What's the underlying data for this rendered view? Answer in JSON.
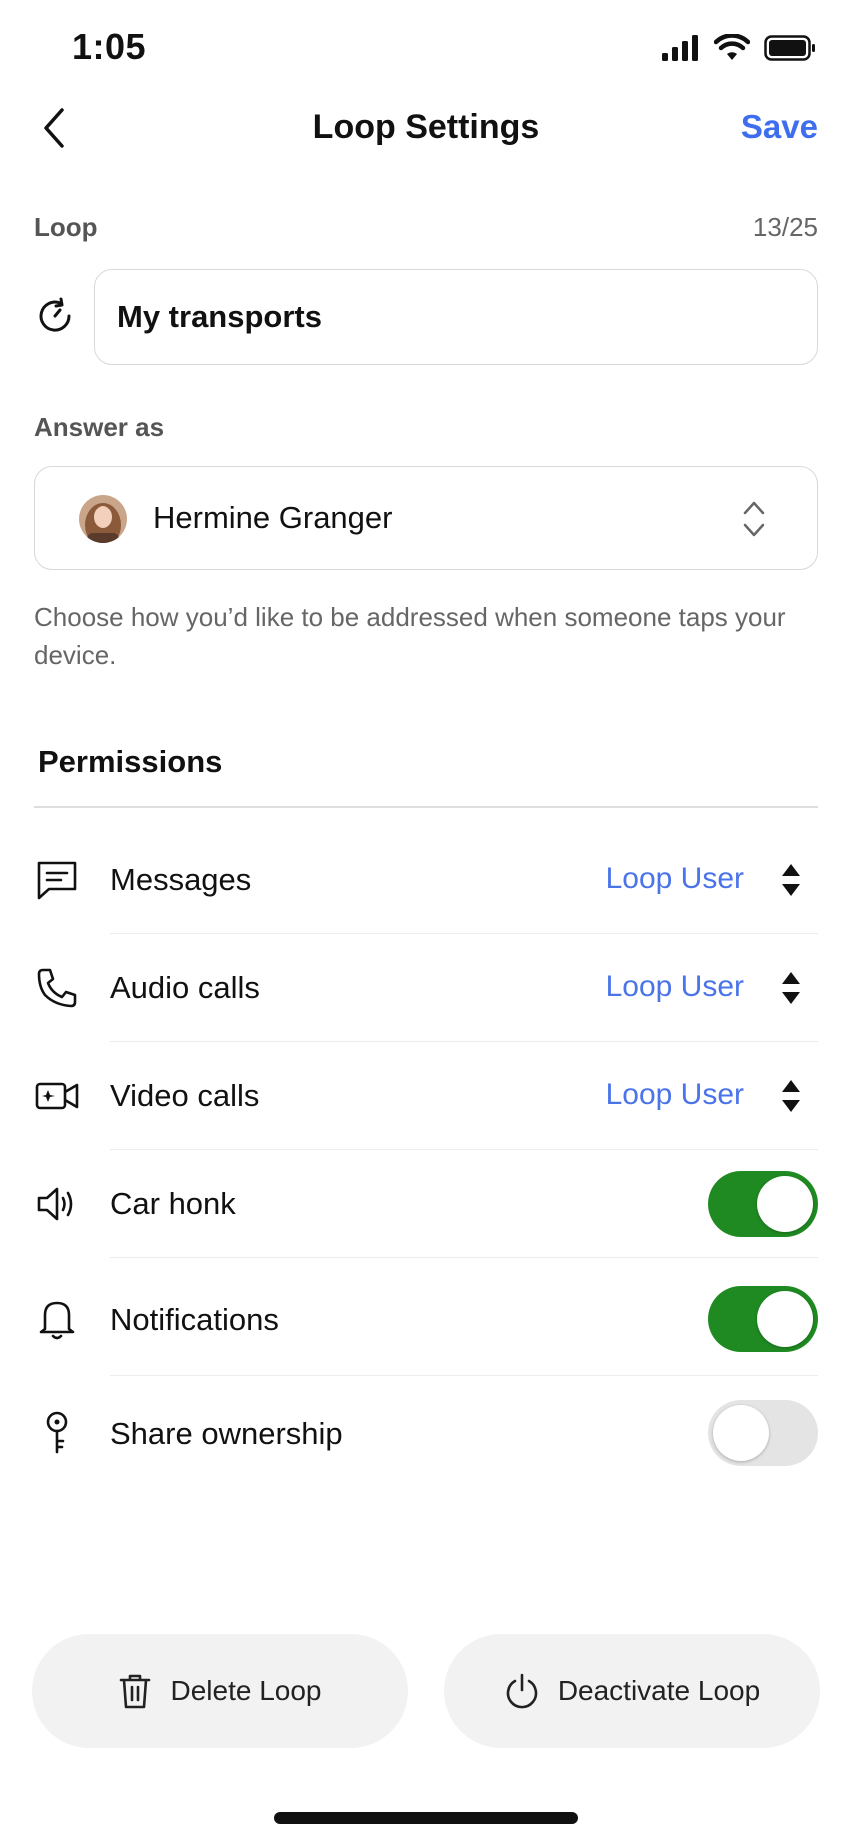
{
  "status_bar": {
    "time": "1:05"
  },
  "nav": {
    "title": "Loop Settings",
    "save_label": "Save"
  },
  "loop": {
    "label": "Loop",
    "counter": "13/25",
    "value": "My transports"
  },
  "answer_as": {
    "label": "Answer as",
    "selected": "Hermine Granger",
    "helper": "Choose how you’d like to be addressed when someone taps your device."
  },
  "permissions": {
    "title": "Permissions",
    "rows": [
      {
        "label": "Messages",
        "value": "Loop User",
        "icon": "message-icon"
      },
      {
        "label": "Audio calls",
        "value": "Loop User",
        "icon": "phone-icon"
      },
      {
        "label": "Video calls",
        "value": "Loop User",
        "icon": "video-icon"
      },
      {
        "label": "Car honk",
        "toggle": true,
        "icon": "speaker-icon"
      },
      {
        "label": "Notifications",
        "toggle": true,
        "icon": "bell-icon"
      },
      {
        "label": "Share ownership",
        "toggle": false,
        "icon": "key-icon"
      }
    ]
  },
  "actions": {
    "delete_label": "Delete Loop",
    "deactivate_label": "Deactivate Loop"
  },
  "colors": {
    "accent": "#3e6df0",
    "toggle_on": "#1f8a22",
    "toggle_off": "#e4e4e4"
  }
}
